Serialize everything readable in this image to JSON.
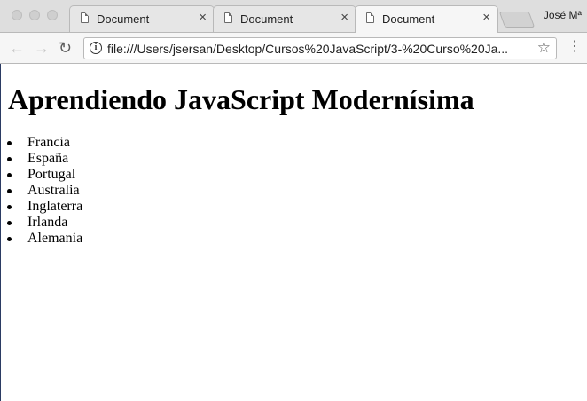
{
  "tabs": [
    {
      "label": "Document",
      "close": "×"
    },
    {
      "label": "Document",
      "close": "×"
    },
    {
      "label": "Document",
      "close": "×"
    }
  ],
  "profile": "José Mª",
  "address_bar": {
    "url": "file:///Users/jsersan/Desktop/Cursos%20JavaScript/3-%20Curso%20Ja..."
  },
  "page": {
    "heading": "Aprendiendo JavaScript Modernísima",
    "list_items": [
      "Francia",
      "España",
      "Portugal",
      "Australia",
      "Inglaterra",
      "Irlanda",
      "Alemania"
    ]
  },
  "icons": {
    "back": "back-arrow-icon",
    "forward": "forward-arrow-icon",
    "reload": "reload-icon",
    "info": "info-icon",
    "star": "bookmark-star-icon",
    "menu": "more-vert-icon"
  }
}
